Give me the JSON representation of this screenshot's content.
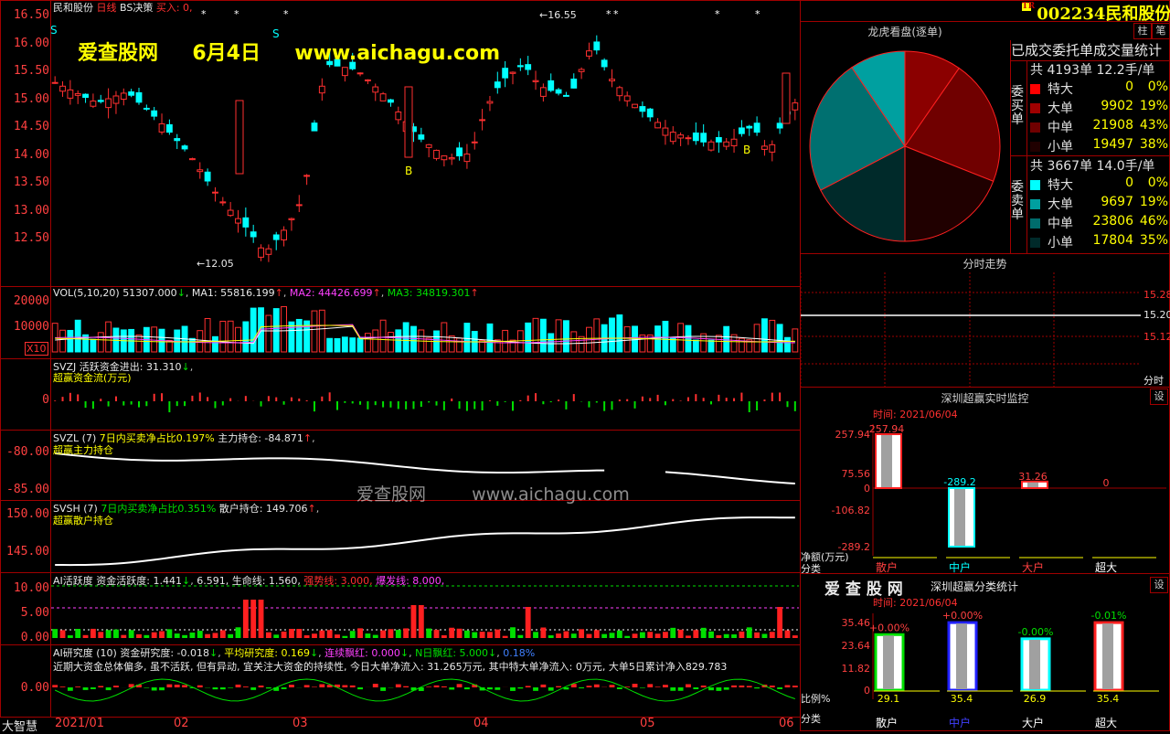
{
  "stock": {
    "code": "002234",
    "name": "民和股份",
    "header": "民和股份",
    "period": "日线",
    "strategy": "BS决策",
    "buy": "买入: 0,",
    "badge": "TR"
  },
  "watermark": {
    "site": "爱查股网",
    "date": "6月4日",
    "url": "www.aichagu.com",
    "center_cn": "爱查股网",
    "center_url": "www.aichagu.com"
  },
  "main_axis": [
    "16.50",
    "16.00",
    "15.50",
    "15.00",
    "14.50",
    "14.00",
    "13.50",
    "13.00",
    "12.50"
  ],
  "main_annot": {
    "high": "16.55",
    "low": "12.05",
    "s": "S",
    "b": "B"
  },
  "vol": {
    "label": "VOL(5,10,20)",
    "v": "51307.000",
    "ma1": "MA1: 55816.199",
    "ma2": "MA2: 44426.699",
    "ma3": "MA3: 34819.301",
    "axis": [
      "20000",
      "10000"
    ],
    "unit": "X10"
  },
  "svzj": {
    "label": "SVZJ",
    "t1": "活跃资金进出: 31.310",
    "t2": "超赢资金流(万元)",
    "axis": [
      "0"
    ]
  },
  "svzl": {
    "label": "SVZL (7)",
    "t1": "7日内买卖净占比0.197%",
    "t2": "主力持仓: -84.871",
    "t3": "超赢主力持仓",
    "axis": [
      "-80.00",
      "-85.00"
    ]
  },
  "svsh": {
    "label": "SVSH (7)",
    "t1": "7日内买卖净占比0.351%",
    "t2": "散户持仓: 149.706",
    "t3": "超赢散户持仓",
    "axis": [
      "150.00",
      "145.00"
    ]
  },
  "ai_act": {
    "label": "AI活跃度",
    "t1": "资金活跃度: 1.441",
    "t2": "6.591,",
    "t3": "生命线: 1.560,",
    "t4": "强势线: 3.000,",
    "t5": "爆发线: 8.000,",
    "axis": [
      "10.00",
      "5.00",
      "0.00"
    ]
  },
  "ai_res": {
    "label": "AI研究度 (10)",
    "t1": "资金研究度: -0.018",
    "t2": "平均研究度: 0.169",
    "t3": "连续飘红: 0.000",
    "t4": "N日飘红: 5.000",
    "t5": "0.18%",
    "desc": "近期大资金总体偏多, 虽不活跃, 但有异动, 宜关注大资金的持续性, 今日大单净流入: 31.265万元, 其中特大单净流入: 0万元, 大单5日累计净入829.783",
    "axis": [
      "0.00"
    ],
    "corner": "大智慧"
  },
  "xaxis": [
    "2021/01",
    "02",
    "03",
    "04",
    "05",
    "06"
  ],
  "right": {
    "lhk_title": "龙虎看盘(逐单)",
    "stats_title": "已成交委托单成交量统计",
    "buy_label": "委买单",
    "sell_label": "委卖单",
    "buy_total": "共 4193单 12.2手/单",
    "sell_total": "共 3667单 14.0手/单",
    "buy_rows": [
      {
        "name": "特大",
        "count": "0",
        "pct": "0%",
        "color": "#ff0000"
      },
      {
        "name": "大单",
        "count": "9902",
        "pct": "19%",
        "color": "#a00000"
      },
      {
        "name": "中单",
        "count": "21908",
        "pct": "43%",
        "color": "#700000"
      },
      {
        "name": "小单",
        "count": "19497",
        "pct": "38%",
        "color": "#200000"
      }
    ],
    "sell_rows": [
      {
        "name": "特大",
        "count": "0",
        "pct": "0%",
        "color": "#00ffff"
      },
      {
        "name": "大单",
        "count": "9697",
        "pct": "19%",
        "color": "#00a0a0"
      },
      {
        "name": "中单",
        "count": "23806",
        "pct": "46%",
        "color": "#006c6c"
      },
      {
        "name": "小单",
        "count": "17804",
        "pct": "35%",
        "color": "#002a2a"
      }
    ],
    "pie_values": [
      9902,
      21908,
      19497,
      17804,
      23806,
      9697
    ],
    "intraday_title": "分时走势",
    "intraday_axis": [
      "15.28",
      "15.20",
      "15.12"
    ],
    "intraday_unit": "分时",
    "btn_zhu": "柱",
    "btn_bi": "笔",
    "btn_set": "设",
    "rt_title": "深圳超赢实时监控",
    "rt_time": "时间: 2021/06/04",
    "rt_axis": [
      "257.94",
      "75.56",
      "0",
      "-106.82",
      "-289.2"
    ],
    "rt_values": [
      {
        "label": "257.94",
        "v": 257.94
      },
      {
        "label": "-289.2",
        "v": -289.2
      },
      {
        "label": "31.26",
        "v": 31.26
      },
      {
        "label": "0",
        "v": 0
      }
    ],
    "rt_unit": "净额(万元)",
    "rt_cat": "分类",
    "cats": [
      "散户",
      "中户",
      "大户",
      "超大"
    ],
    "cls_brand": "爱 查 股 网",
    "cls_title": "深圳超赢分类统计",
    "cls_time": "时间: 2021/06/04",
    "cls_axis": [
      "35.46",
      "23.64",
      "11.82",
      "0"
    ],
    "cls_values": [
      {
        "top": "+0.00%",
        "bottom": "29.1",
        "v": 29.1,
        "color": "#00e000"
      },
      {
        "top": "+0.00%",
        "bottom": "35.4",
        "v": 35.4,
        "color": "#2020ff"
      },
      {
        "top": "-0.00%",
        "bottom": "26.9",
        "v": 26.9,
        "color": "#00ffff"
      },
      {
        "top": "-0.01%",
        "bottom": "35.4",
        "v": 35.4,
        "color": "#ff2020"
      }
    ],
    "cls_unit": "比例%",
    "cls_cat": "分类"
  }
}
